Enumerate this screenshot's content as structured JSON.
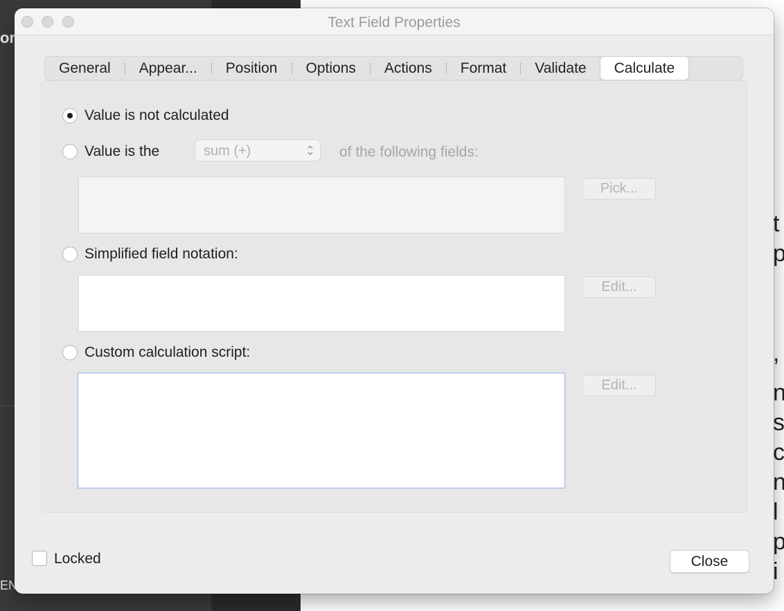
{
  "background": {
    "left_fragments": [
      "or",
      "EN"
    ],
    "right_fragments": [
      "t",
      "p",
      ",",
      "n",
      "s",
      "c",
      "n",
      "l",
      "p",
      "i"
    ]
  },
  "window": {
    "title": "Text Field Properties"
  },
  "tabs": [
    {
      "label": "General"
    },
    {
      "label": "Appear..."
    },
    {
      "label": "Position"
    },
    {
      "label": "Options"
    },
    {
      "label": "Actions"
    },
    {
      "label": "Format"
    },
    {
      "label": "Validate"
    },
    {
      "label": "Calculate",
      "active": true
    }
  ],
  "calculate": {
    "not_calculated_label": "Value is not calculated",
    "value_is_label": "Value is the",
    "operation_select": {
      "value": "sum (+)"
    },
    "following_fields_label": "of the following fields:",
    "pick_button": "Pick...",
    "simplified_label": "Simplified field notation:",
    "simplified_edit_button": "Edit...",
    "custom_label": "Custom calculation script:",
    "custom_edit_button": "Edit...",
    "selected_option": "Value is not calculated"
  },
  "footer": {
    "locked_label": "Locked",
    "locked_checked": false,
    "close_button": "Close"
  }
}
